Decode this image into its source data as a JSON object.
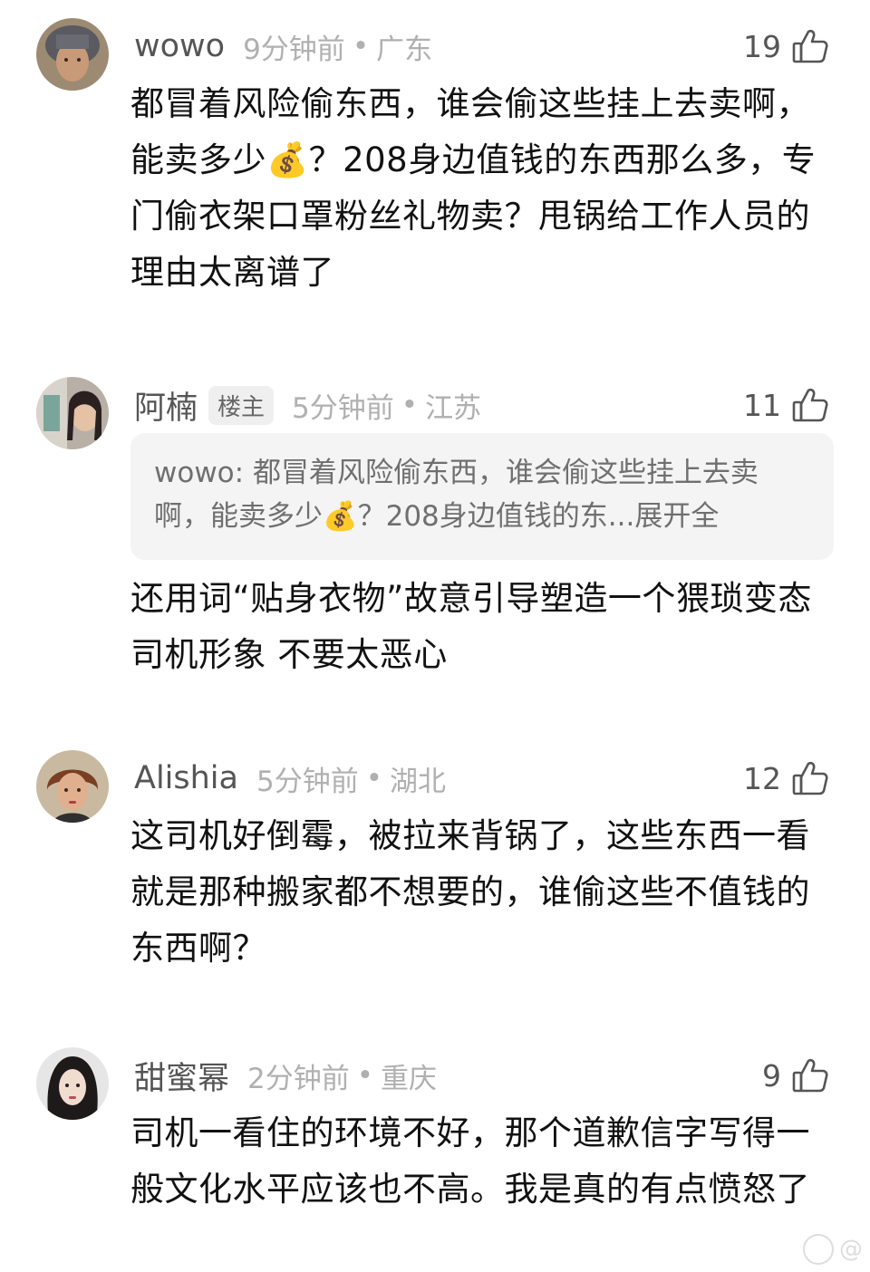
{
  "comments": [
    {
      "username": "wowo",
      "badge": "",
      "time": "9分钟前",
      "separator": "•",
      "region": "广东",
      "likes": "19",
      "text_before_emoji": "都冒着风险偷东西，谁会偷这些挂上去卖啊，能卖多少",
      "emoji": "💰",
      "text_after_emoji": "？208身边值钱的东西那么多，专门偷衣架口罩粉丝礼物卖？甩锅给工作人员的理由太离谱了",
      "avatar_icon": "avatar-photo"
    },
    {
      "username": "阿楠",
      "badge": "楼主",
      "time": "5分钟前",
      "separator": "•",
      "region": "江苏",
      "likes": "11",
      "quote_before_emoji": "wowo: 都冒着风险偷东西，谁会偷这些挂上去卖啊，能卖多少",
      "quote_emoji": "💰",
      "quote_after_emoji": "？208身边值钱的东...",
      "quote_expand": "展开全",
      "text": "还用词“贴身衣物”故意引导塑造一个猥琐变态司机形象 不要太恶心",
      "avatar_icon": "avatar-photo"
    },
    {
      "username": "Alishia",
      "badge": "",
      "time": "5分钟前",
      "separator": "•",
      "region": "湖北",
      "likes": "12",
      "text": "这司机好倒霉，被拉来背锅了，这些东西一看就是那种搬家都不想要的，谁偷这些不值钱的东西啊？",
      "avatar_icon": "avatar-photo"
    },
    {
      "username": "甜蜜幂",
      "badge": "",
      "time": "2分钟前",
      "separator": "•",
      "region": "重庆",
      "likes": "9",
      "text": "司机一看住的环境不好，那个道歉信字写得一般文化水平应该也不高。我是真的有点愤怒了",
      "avatar_icon": "avatar-photo"
    }
  ],
  "icons": {
    "like": "thumbs-up-icon"
  },
  "colors": {
    "username": "#555555",
    "meta": "#b0b0b0",
    "body_text": "#111111",
    "quote_bg": "#f4f4f4",
    "quote_text": "#6f6f6f"
  },
  "watermark": {
    "text": "@"
  }
}
